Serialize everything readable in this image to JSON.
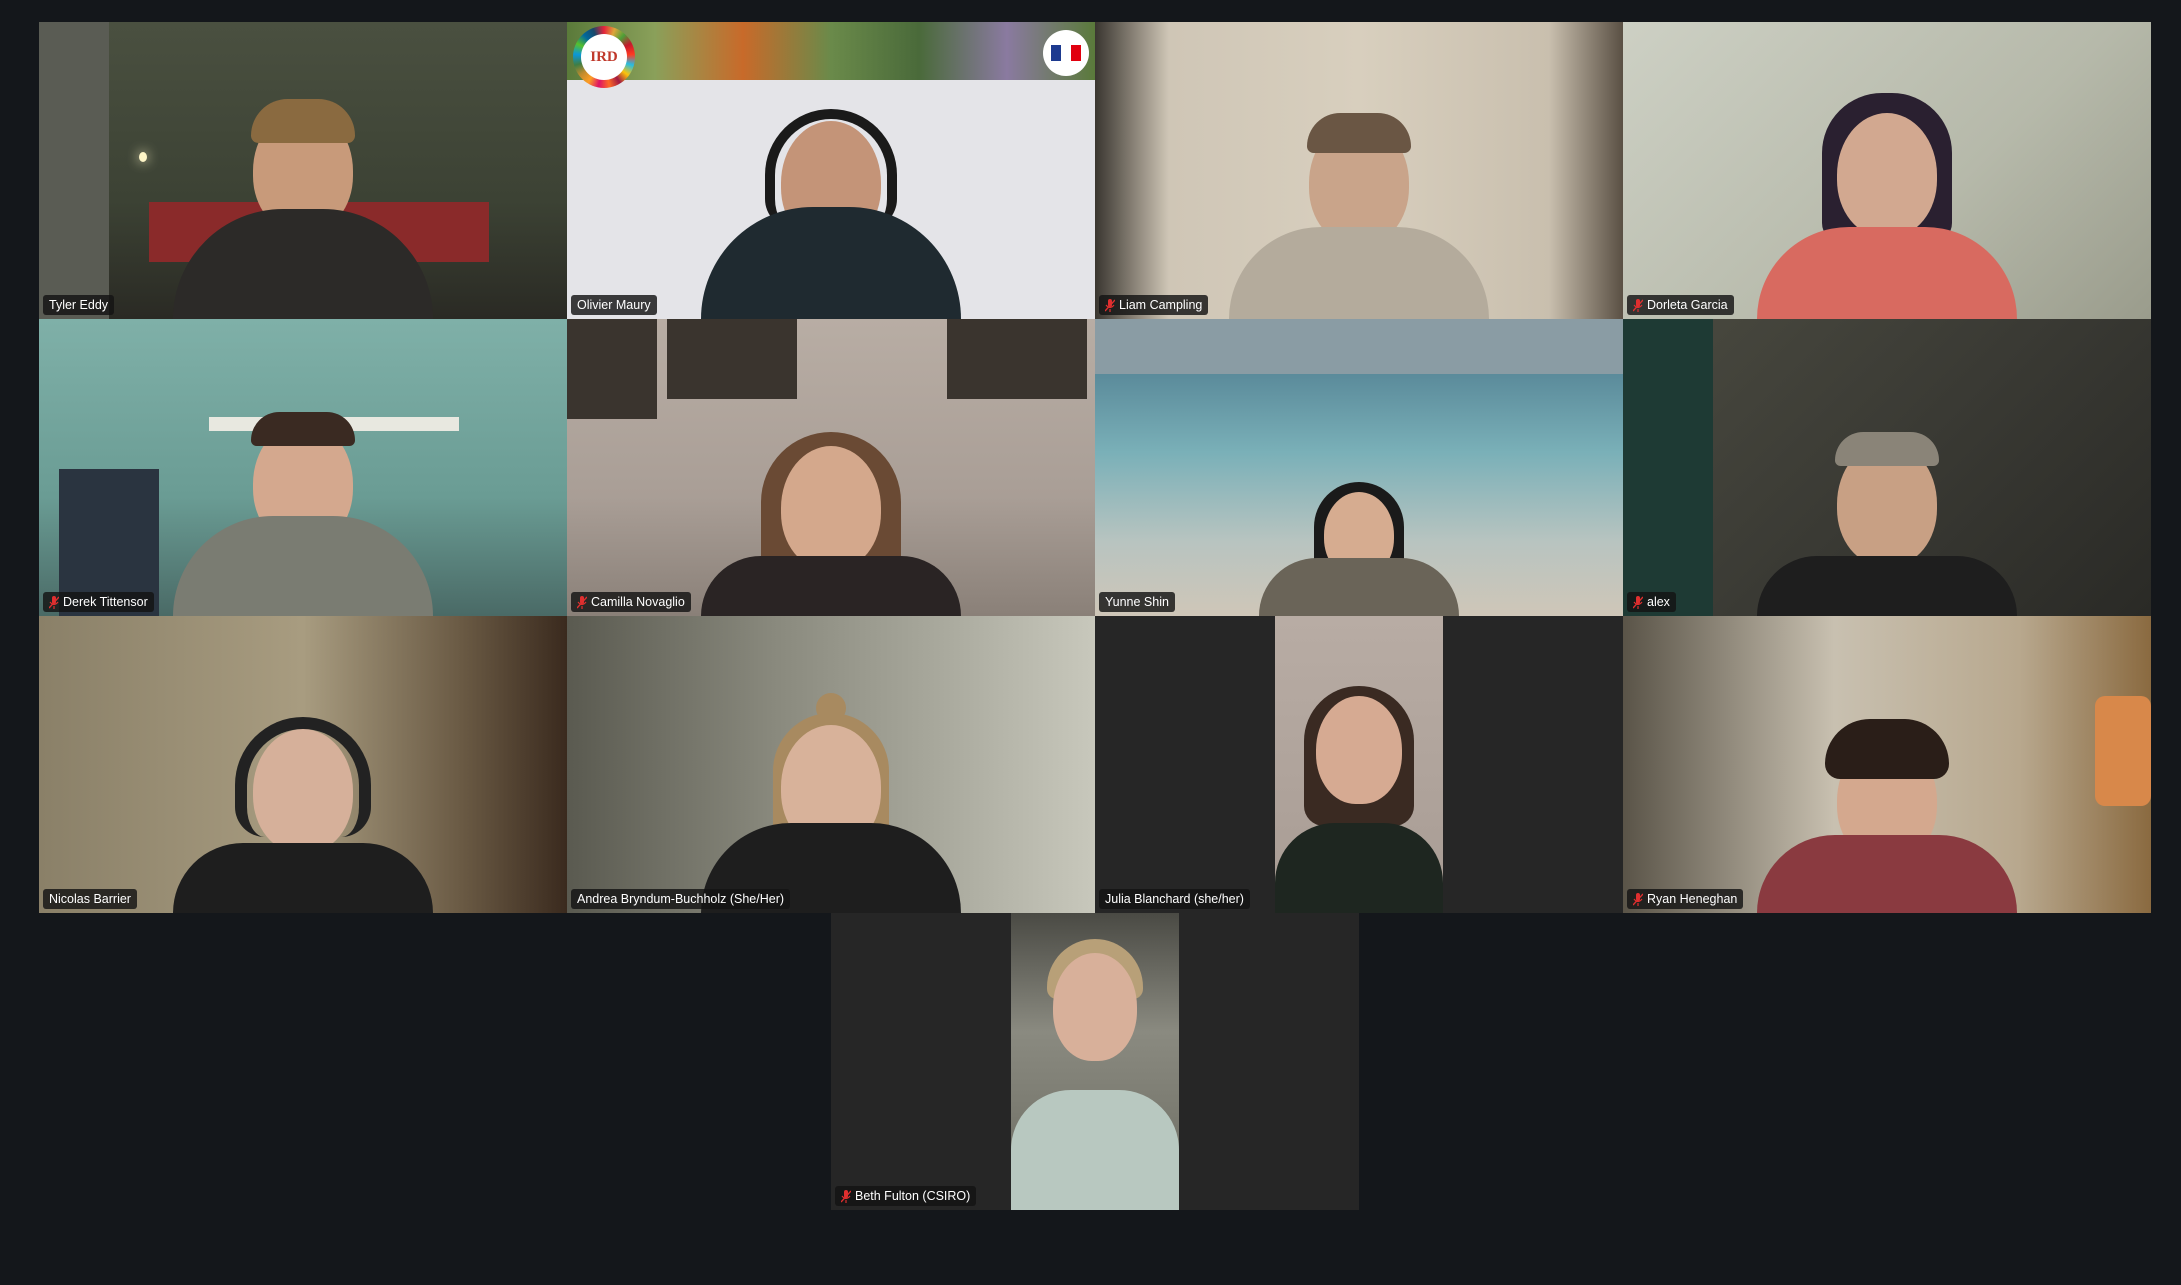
{
  "meeting": {
    "active_speaker": "Julia Blanchard (she/her)",
    "participants": [
      {
        "name": "Tyler Eddy",
        "muted": false
      },
      {
        "name": "Olivier Maury",
        "muted": false
      },
      {
        "name": "Liam Campling",
        "muted": true
      },
      {
        "name": "Dorleta Garcia",
        "muted": true
      },
      {
        "name": "Derek Tittensor",
        "muted": true
      },
      {
        "name": "Camilla Novaglio",
        "muted": true
      },
      {
        "name": "Yunne Shin",
        "muted": false
      },
      {
        "name": "alex",
        "muted": true
      },
      {
        "name": "Nicolas Barrier",
        "muted": false
      },
      {
        "name": "Andrea Bryndum-Buchholz (She/Her)",
        "muted": false
      },
      {
        "name": "Julia Blanchard (she/her)",
        "muted": false
      },
      {
        "name": "Ryan Heneghan",
        "muted": true
      },
      {
        "name": "Beth Fulton (CSIRO)",
        "muted": true
      }
    ]
  },
  "colors": {
    "background": "#14171b",
    "active_border": "#2ecc40",
    "mute_icon": "#e02f2f"
  },
  "icons": {
    "muted": "mic-muted-icon"
  },
  "virtual_background": {
    "logo_text": "IRD"
  }
}
